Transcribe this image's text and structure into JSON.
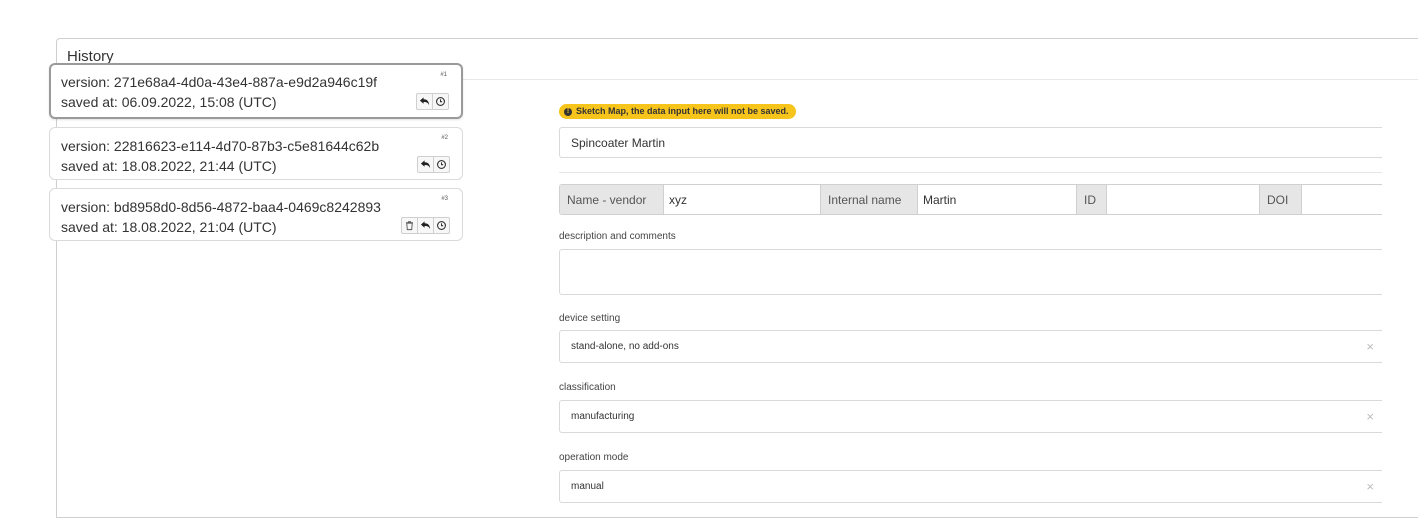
{
  "history": {
    "title": "History",
    "versions": [
      {
        "version_line": "version: 271e68a4-4d0a-43e4-887a-e9d2a946c19f",
        "saved_line": "saved at: 06.09.2022, 15:08 (UTC)",
        "number": "#1",
        "actions": [
          "undo-icon",
          "clock-icon"
        ]
      },
      {
        "version_line": "version: 22816623-e114-4d70-87b3-c5e81644c62b",
        "saved_line": "saved at: 18.08.2022, 21:44 (UTC)",
        "number": "#2",
        "actions": [
          "undo-icon",
          "clock-icon"
        ]
      },
      {
        "version_line": "version: bd8958d0-8d56-4872-baa4-0469c8242893",
        "saved_line": "saved at: 18.08.2022, 21:04 (UTC)",
        "number": "#3",
        "actions": [
          "trash-icon",
          "undo-icon",
          "clock-icon"
        ]
      }
    ]
  },
  "form": {
    "warning": "Sketch Map, the data input here will not be saved.",
    "title_value": "Spincoater Martin",
    "identifiers": [
      {
        "label": "Name - vendor",
        "value": "xyz"
      },
      {
        "label": "Internal name",
        "value": "Martin"
      },
      {
        "label": "ID",
        "value": ""
      },
      {
        "label": "DOI",
        "value": ""
      }
    ],
    "description_label": "description and comments",
    "description_value": "",
    "device_setting": {
      "label": "device setting",
      "value": "stand-alone, no add-ons",
      "clear": "×"
    },
    "classification": {
      "label": "classification",
      "value": "manufacturing",
      "clear": "×"
    },
    "operation_mode": {
      "label": "operation mode",
      "value": "manual",
      "clear": "×"
    }
  },
  "colors": {
    "warning_badge": "#f7c41c",
    "label_background": "#e6e6e6",
    "border": "#d9d9d9"
  }
}
